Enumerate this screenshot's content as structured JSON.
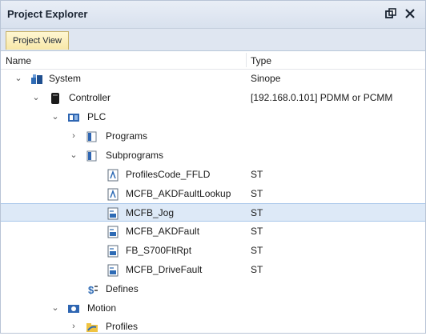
{
  "panel": {
    "title": "Project Explorer",
    "icons": [
      "restore-icon",
      "close-icon"
    ],
    "tab": "Project View"
  },
  "columns": {
    "name": "Name",
    "type": "Type"
  },
  "tree": [
    {
      "label": "System",
      "type": "Sinope",
      "icon": "system-icon",
      "expanded": true
    },
    {
      "label": "Controller",
      "type": "[192.168.0.101] PDMM or PCMM",
      "icon": "controller-icon",
      "expanded": true
    },
    {
      "label": "PLC",
      "type": "",
      "icon": "plc-icon",
      "expanded": true
    },
    {
      "label": "Programs",
      "type": "",
      "icon": "folder-icon",
      "expanded": false
    },
    {
      "label": "Subprograms",
      "type": "",
      "icon": "folder-icon",
      "expanded": true
    },
    {
      "label": "ProfilesCode_FFLD",
      "type": "ST",
      "icon": "ffld-icon"
    },
    {
      "label": "MCFB_AKDFaultLookup",
      "type": "ST",
      "icon": "ffld-icon"
    },
    {
      "label": "MCFB_Jog",
      "type": "ST",
      "icon": "st-icon",
      "selected": true
    },
    {
      "label": "MCFB_AKDFault",
      "type": "ST",
      "icon": "st-icon"
    },
    {
      "label": "FB_S700FltRpt",
      "type": "ST",
      "icon": "st-icon"
    },
    {
      "label": "MCFB_DriveFault",
      "type": "ST",
      "icon": "st-icon"
    },
    {
      "label": "Defines",
      "type": "",
      "icon": "defines-icon"
    },
    {
      "label": "Motion",
      "type": "",
      "icon": "motion-icon",
      "expanded": true
    },
    {
      "label": "Profiles",
      "type": "",
      "icon": "profiles-icon",
      "expanded": false
    }
  ],
  "colors": {
    "selection": "#dde9f7",
    "titlebar": "#dfe6f1",
    "tab": "#f7e7a8"
  }
}
